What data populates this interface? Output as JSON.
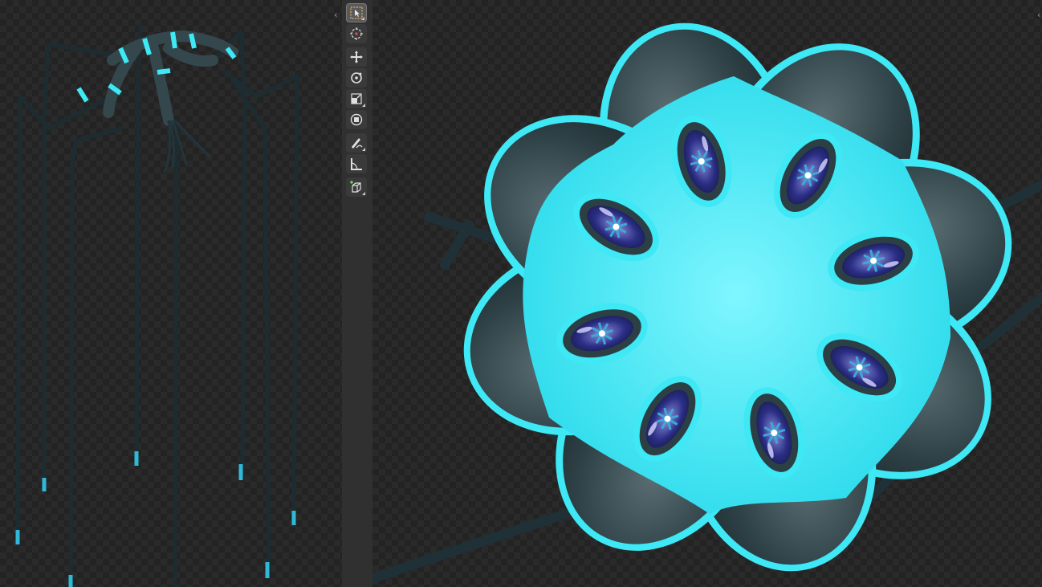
{
  "toolbar": {
    "tools": [
      {
        "name": "select-box-tool",
        "icon": "select-box-icon",
        "active": true
      },
      {
        "name": "cursor-tool",
        "icon": "cursor-icon",
        "active": false
      },
      {
        "name": "move-tool",
        "icon": "move-icon",
        "active": false
      },
      {
        "name": "rotate-tool",
        "icon": "rotate-icon",
        "active": false
      },
      {
        "name": "scale-tool",
        "icon": "scale-icon",
        "active": false
      },
      {
        "name": "transform-tool",
        "icon": "transform-icon",
        "active": false
      },
      {
        "name": "annotate-tool",
        "icon": "annotate-icon",
        "active": false
      },
      {
        "name": "measure-tool",
        "icon": "measure-icon",
        "active": false
      },
      {
        "name": "add-cube-tool",
        "icon": "add-cube-icon",
        "active": false
      }
    ]
  },
  "colors": {
    "accent_cyan": "#3ee8f5",
    "body_dark": "#2b3f45",
    "toolbar_bg": "#303030",
    "viewport_checker": "#2a2a2a"
  }
}
